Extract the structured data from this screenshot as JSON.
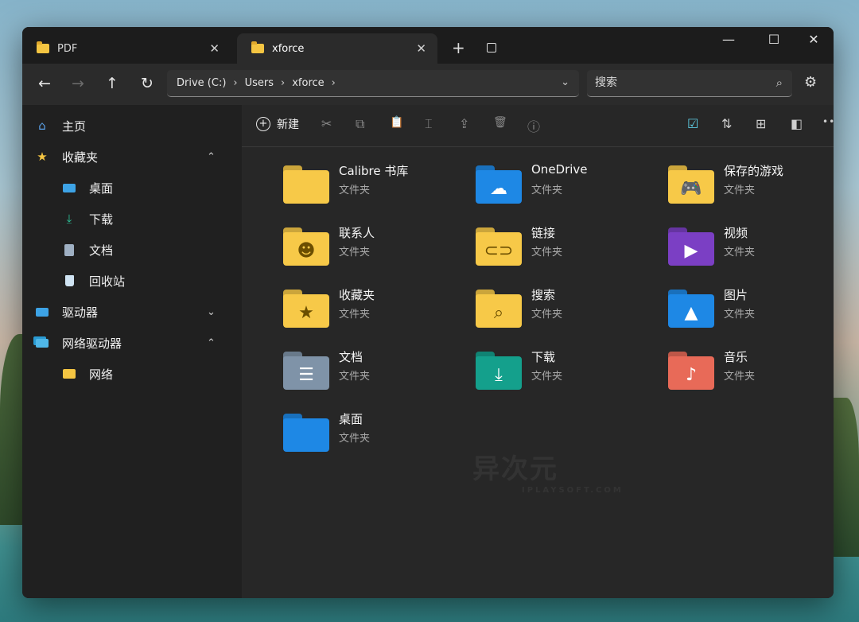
{
  "window": {
    "tabs": [
      {
        "label": "PDF",
        "close": "✕"
      },
      {
        "label": "xforce",
        "close": "✕"
      }
    ],
    "new_tab": "+",
    "controls": {
      "minimize": "—",
      "maximize": "☐",
      "close": "✕"
    }
  },
  "nav": {
    "back": "←",
    "forward": "→",
    "up": "↑",
    "refresh": "↻",
    "breadcrumb": [
      "Drive (C:)",
      "Users",
      "xforce"
    ],
    "sep": "›",
    "dropdown": "⌄",
    "search_placeholder": "搜索",
    "settings": "⚙"
  },
  "sidebar": {
    "items": [
      {
        "label": "主页",
        "icon": "home-icon"
      },
      {
        "label": "收藏夹",
        "icon": "star-icon",
        "caret": "^"
      },
      {
        "label": "桌面",
        "icon": "desktop-icon"
      },
      {
        "label": "下载",
        "icon": "download-icon"
      },
      {
        "label": "文档",
        "icon": "document-icon"
      },
      {
        "label": "回收站",
        "icon": "recycle-bin-icon"
      },
      {
        "label": "驱动器",
        "icon": "drive-icon",
        "caret": "⌄"
      },
      {
        "label": "网络驱动器",
        "icon": "network-drive-icon",
        "caret": "^"
      },
      {
        "label": "网络",
        "icon": "network-folder-icon"
      }
    ]
  },
  "commandbar": {
    "new_label": "新建",
    "cut": "✂",
    "copy": "⧉",
    "paste": "📋",
    "rename": "⌶",
    "share": "⇪",
    "delete": "🗑",
    "info": "ⓘ",
    "more": "•••"
  },
  "files": [
    {
      "name": "Calibre 书库",
      "type": "文件夹",
      "icon": "folder-icon",
      "color": "#f7c948",
      "glyph": ""
    },
    {
      "name": "OneDrive",
      "type": "文件夹",
      "icon": "onedrive-folder-icon",
      "color": "#1e88e5",
      "glyph": "☁"
    },
    {
      "name": "保存的游戏",
      "type": "文件夹",
      "icon": "saved-games-folder-icon",
      "color": "#f7c948",
      "glyph": "🎮"
    },
    {
      "name": "联系人",
      "type": "文件夹",
      "icon": "contacts-folder-icon",
      "color": "#f7c948",
      "glyph": "☻"
    },
    {
      "name": "链接",
      "type": "文件夹",
      "icon": "links-folder-icon",
      "color": "#f7c948",
      "glyph": "⊂⊃"
    },
    {
      "name": "视频",
      "type": "文件夹",
      "icon": "videos-folder-icon",
      "color": "#7b3fc4",
      "glyph": "▶"
    },
    {
      "name": "收藏夹",
      "type": "文件夹",
      "icon": "favorites-folder-icon",
      "color": "#f7c948",
      "glyph": "★"
    },
    {
      "name": "搜索",
      "type": "文件夹",
      "icon": "searches-folder-icon",
      "color": "#f7c948",
      "glyph": "⌕"
    },
    {
      "name": "图片",
      "type": "文件夹",
      "icon": "pictures-folder-icon",
      "color": "#1e88e5",
      "glyph": "▲"
    },
    {
      "name": "文档",
      "type": "文件夹",
      "icon": "documents-folder-icon",
      "color": "#7f93a8",
      "glyph": "☰"
    },
    {
      "name": "下载",
      "type": "文件夹",
      "icon": "downloads-folder-icon",
      "color": "#14a08c",
      "glyph": "⤓"
    },
    {
      "name": "音乐",
      "type": "文件夹",
      "icon": "music-folder-icon",
      "color": "#e86a58",
      "glyph": "♪"
    },
    {
      "name": "桌面",
      "type": "文件夹",
      "icon": "desktop-folder-icon",
      "color": "#1e88e5",
      "glyph": ""
    }
  ],
  "watermark": {
    "main": "异次元",
    "sub": "IPLAYSOFT.COM"
  }
}
